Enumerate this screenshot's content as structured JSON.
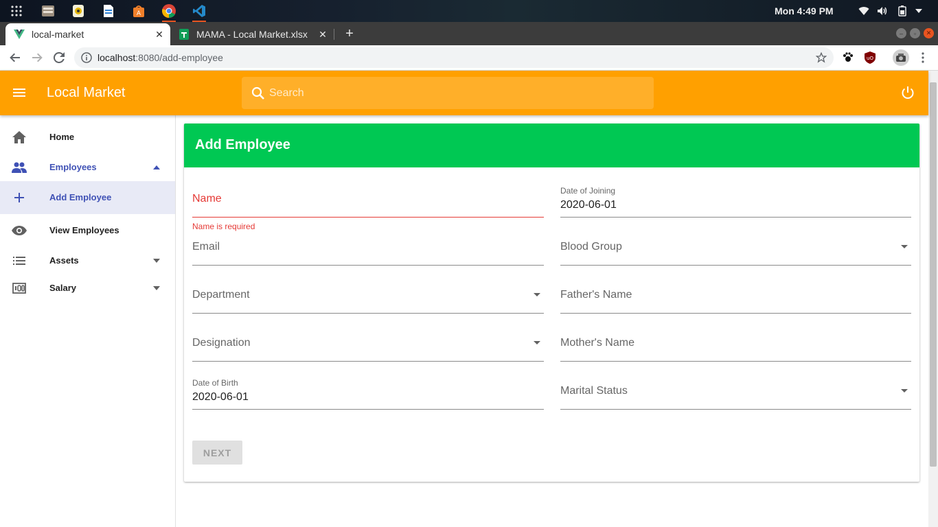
{
  "os": {
    "clock": "Mon  4:49 PM",
    "apps": [
      {
        "name": "app-grid-icon"
      },
      {
        "name": "files-icon"
      },
      {
        "name": "rhythmbox-icon"
      },
      {
        "name": "writer-icon"
      },
      {
        "name": "software-center-icon"
      },
      {
        "name": "chrome-icon"
      },
      {
        "name": "vscode-icon"
      }
    ]
  },
  "browser": {
    "tabs": [
      {
        "title": "local-market",
        "active": true
      },
      {
        "title": "MAMA - Local Market.xlsx",
        "active": false
      }
    ],
    "url_host": "localhost",
    "url_path": ":8080/add-employee"
  },
  "app": {
    "title": "Local Market",
    "search_placeholder": "Search",
    "colors": {
      "appbar": "#ffa000",
      "card_header": "#00c853",
      "accent": "#3f51b5",
      "error": "#e53935"
    }
  },
  "sidebar": {
    "items": [
      {
        "label": "Home",
        "icon": "home-icon"
      },
      {
        "label": "Employees",
        "icon": "people-icon",
        "expanded": true
      },
      {
        "label": "Add Employee",
        "icon": "plus-icon",
        "selected": true
      },
      {
        "label": "View Employees",
        "icon": "eye-icon"
      },
      {
        "label": "Assets",
        "icon": "list-icon"
      },
      {
        "label": "Salary",
        "icon": "money-icon"
      }
    ]
  },
  "form": {
    "title": "Add Employee",
    "name_label": "Name",
    "name_error": "Name is required",
    "joining_label": "Date of Joining",
    "joining_value": "2020-06-01",
    "email_label": "Email",
    "blood_label": "Blood Group",
    "department_label": "Department",
    "father_label": "Father's Name",
    "designation_label": "Designation",
    "mother_label": "Mother's Name",
    "dob_label": "Date of Birth",
    "dob_value": "2020-06-01",
    "marital_label": "Marital Status",
    "next_label": "NEXT"
  }
}
